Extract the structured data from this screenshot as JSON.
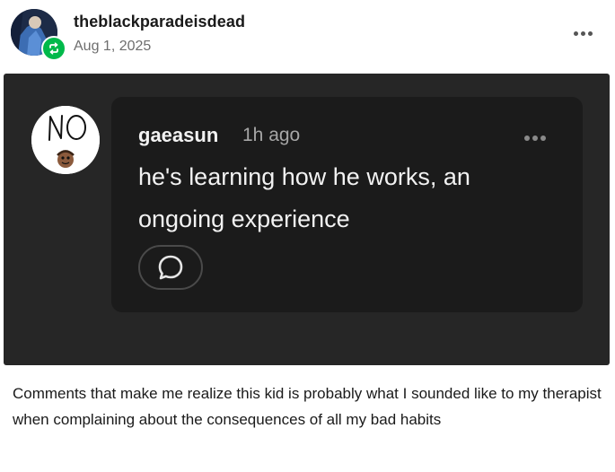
{
  "post": {
    "username": "theblackparadeisdead",
    "date": "Aug 1, 2025",
    "avatar_icon": "user-avatar",
    "reblog_icon": "reblog-icon",
    "more_icon": "more-options-icon"
  },
  "screenshot": {
    "commenter": "gaeasun",
    "time": "1h ago",
    "comment": "he's learning how he works, an ongoing experience",
    "avatar_lettering": "NO",
    "reply_icon": "reply-bubble-icon",
    "more_icon": "more-options-icon"
  },
  "caption": "Comments that make me realize this kid is probably what I sounded like to my therapist when complaining about the consequences of all my bad habits",
  "colors": {
    "reblog_badge": "#00b94a",
    "panel_background": "#262626",
    "card_background": "#1b1b1b"
  }
}
